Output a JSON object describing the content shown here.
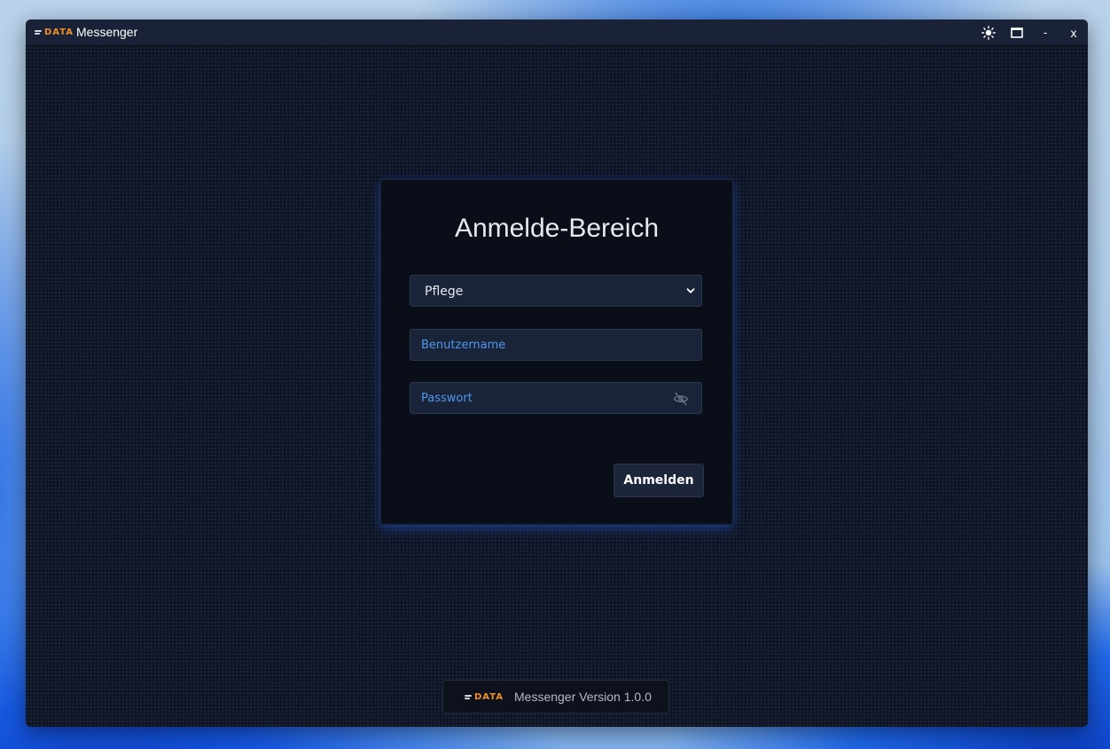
{
  "window": {
    "logo_text": "DATA",
    "title": "Messenger",
    "controls": {
      "theme_icon": "sun-icon",
      "maximize_icon": "maximize-icon",
      "minimize_label": "-",
      "close_label": "x"
    }
  },
  "login": {
    "title": "Anmelde-Bereich",
    "area_select": {
      "selected": "Pflege"
    },
    "username": {
      "placeholder": "Benutzername"
    },
    "password": {
      "placeholder": "Passwort",
      "toggle_icon": "eye-off-icon"
    },
    "submit_label": "Anmelden"
  },
  "footer": {
    "logo_text": "DATA",
    "version_text": "Messenger Version 1.0.0"
  },
  "colors": {
    "brand_orange": "#f0902b",
    "placeholder_blue": "#4f97ee",
    "card_glow": "#2554c8"
  }
}
